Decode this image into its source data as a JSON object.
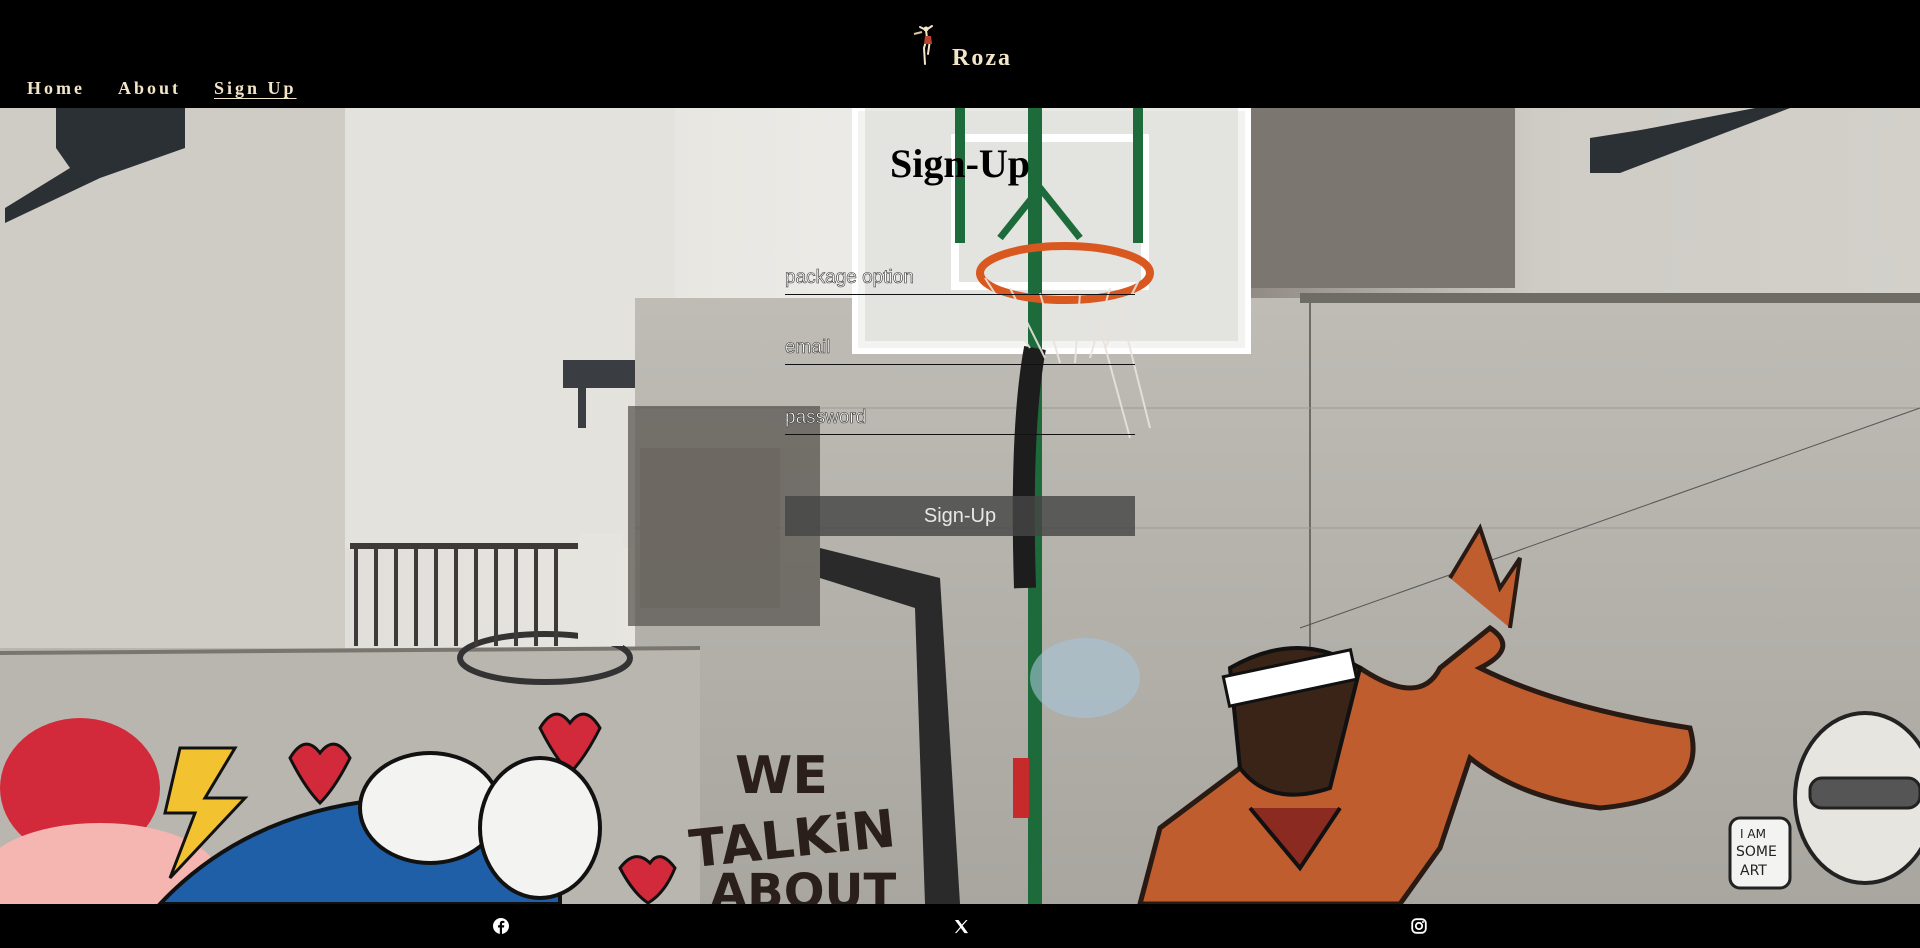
{
  "header": {
    "brand_name": "Roza",
    "nav": {
      "home": "Home",
      "about": "About",
      "signup": "Sign Up"
    }
  },
  "form": {
    "title": "Sign-Up",
    "package_placeholder": "package option",
    "email_placeholder": "email",
    "password_placeholder": "password",
    "submit_label": "Sign-Up"
  },
  "footer": {
    "social": [
      "facebook-icon",
      "x-icon",
      "instagram-icon"
    ]
  },
  "background": {
    "wall_text": [
      "WE",
      "TALKiN",
      "ABOUT"
    ],
    "sticker_text": [
      "I AM",
      "SOME",
      "ART"
    ],
    "colors": {
      "page": "#000000",
      "nav_text": "#f3e6c8",
      "hoop": "#d9581f",
      "pole": "#1d6b3a",
      "wall": "#c9c6c0"
    }
  }
}
